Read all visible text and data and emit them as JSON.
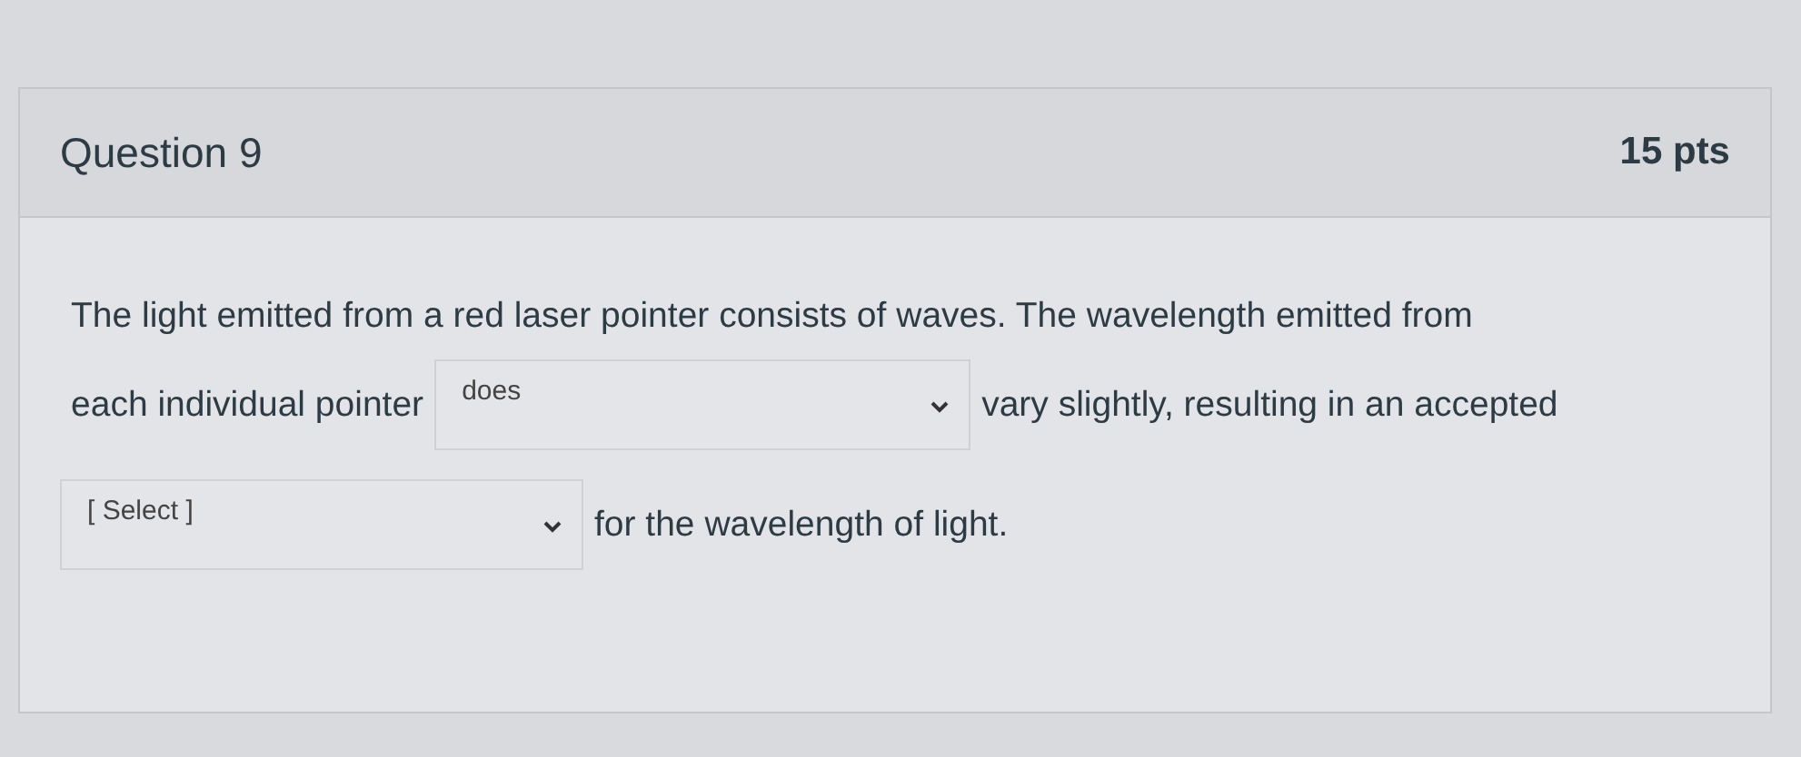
{
  "question": {
    "title": "Question 9",
    "points": "15 pts",
    "lines": [
      [
        {
          "kind": "text",
          "text": "The light emitted from a red laser pointer consists of waves. The wavelength emitted from"
        }
      ],
      [
        {
          "kind": "text",
          "text": "each individual pointer"
        },
        {
          "kind": "dropdown",
          "value": "does"
        },
        {
          "kind": "text",
          "text": "vary slightly, resulting in an accepted"
        }
      ],
      [
        {
          "kind": "dropdown",
          "value": "[ Select ]"
        },
        {
          "kind": "text",
          "text": "for the wavelength of light."
        }
      ]
    ]
  }
}
